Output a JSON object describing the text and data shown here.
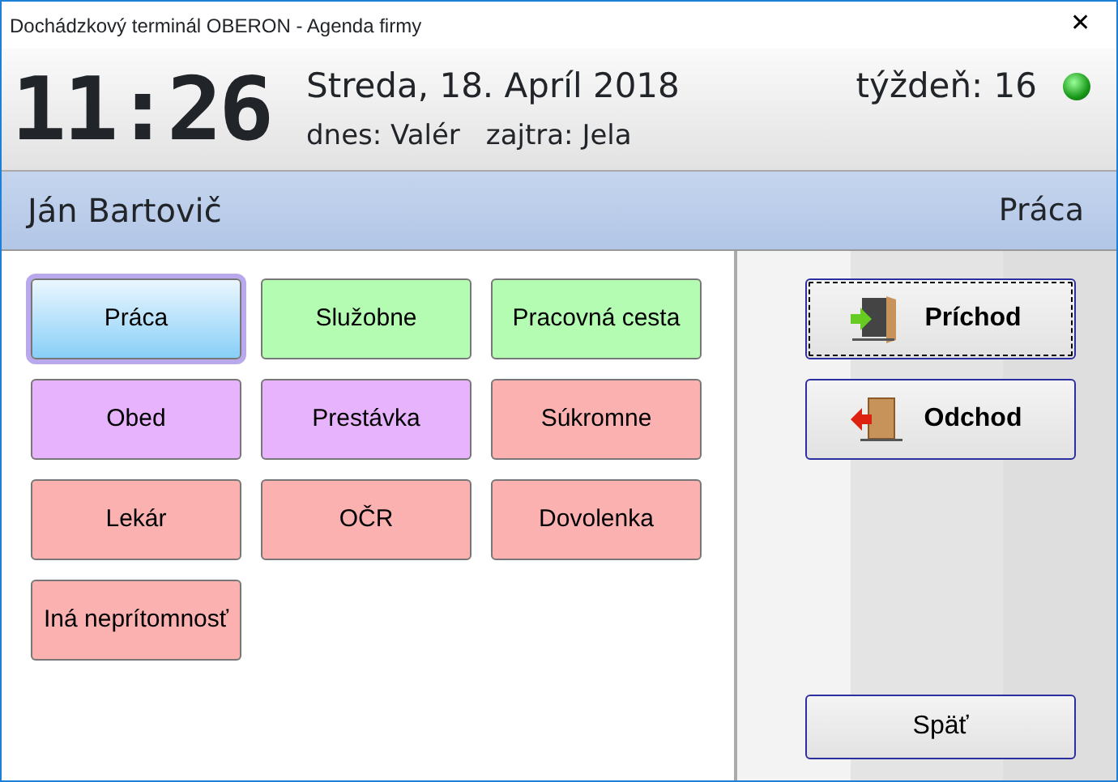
{
  "window": {
    "title": "Dochádzkový terminál OBERON - Agenda firmy",
    "close": "✕"
  },
  "header": {
    "time": "11:26",
    "date": "Streda, 18. Apríl 2018",
    "nameday_today": "dnes: Valér",
    "nameday_tomorrow": "zajtra: Jela",
    "week": "týždeň: 16",
    "online": true
  },
  "employee": {
    "name": "Ján Bartovič",
    "status": "Práca"
  },
  "activities": [
    {
      "label": "Práca",
      "color": "#a8d8f8",
      "selected": true
    },
    {
      "label": "Služobne",
      "color": "#b3fcb1",
      "selected": false
    },
    {
      "label": "Pracovná cesta",
      "color": "#b3fcb1",
      "selected": false
    },
    {
      "label": "Obed",
      "color": "#e6b3fc",
      "selected": false
    },
    {
      "label": "Prestávka",
      "color": "#e6b3fc",
      "selected": false
    },
    {
      "label": "Súkromne",
      "color": "#fcb1b1",
      "selected": false
    },
    {
      "label": "Lekár",
      "color": "#fcb1b1",
      "selected": false
    },
    {
      "label": "OČR",
      "color": "#fcb1b1",
      "selected": false
    },
    {
      "label": "Dovolenka",
      "color": "#fcb1b1",
      "selected": false
    },
    {
      "label": "Iná neprítomnosť",
      "color": "#fcb1b1",
      "selected": false
    }
  ],
  "actions": [
    {
      "label": "Príchod",
      "kind": "arrival",
      "focused": true
    },
    {
      "label": "Odchod",
      "kind": "departure",
      "focused": false
    }
  ],
  "back_button": "Späť"
}
